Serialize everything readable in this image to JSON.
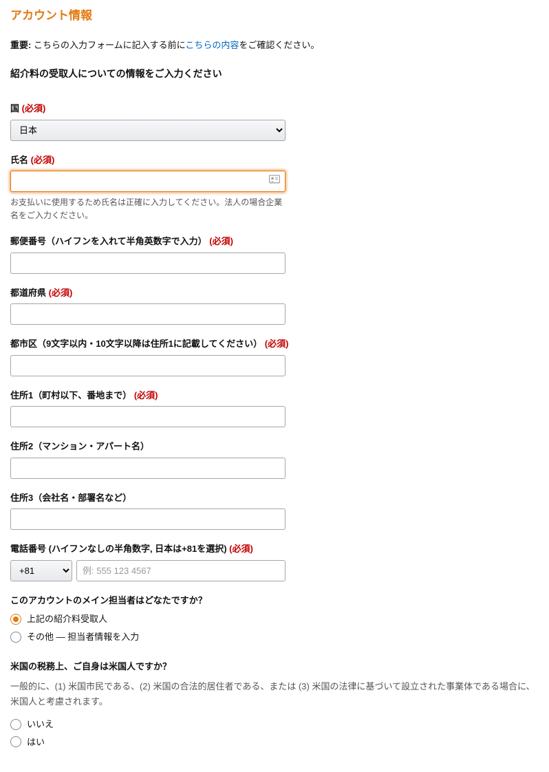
{
  "page_title": "アカウント情報",
  "notice": {
    "important_label": "重要:",
    "text_before": " こちらの入力フォームに記入する前に",
    "link_text": "こちらの内容",
    "text_after": "をご確認ください。"
  },
  "section_heading": "紹介料の受取人についての情報をご入力ください",
  "required_text": "(必須)",
  "country": {
    "label": "国 ",
    "value": "日本"
  },
  "name": {
    "label": "氏名 ",
    "help": "お支払いに使用するため氏名は正確に入力してください。法人の場合企業名をご入力ください。"
  },
  "postal": {
    "label": "郵便番号（ハイフンを入れて半角英数字で入力） "
  },
  "prefecture": {
    "label": "都道府県 "
  },
  "city": {
    "label": "都市区（9文字以内・10文字以降は住所1に記載してください） "
  },
  "address1": {
    "label": "住所1（町村以下、番地まで） "
  },
  "address2": {
    "label": "住所2（マンション・アパート名）"
  },
  "address3": {
    "label": "住所3（会社名・部署名など）"
  },
  "phone": {
    "label": "電話番号 (ハイフンなしの半角数字, 日本は+81を選択) ",
    "prefix": "+81",
    "placeholder": "例: 555 123 4567"
  },
  "main_contact": {
    "question": "このアカウントのメイン担当者はどなたですか？",
    "option1": "上記の紹介料受取人",
    "option2": "その他 — 担当者情報を入力"
  },
  "us_tax": {
    "question": "米国の税務上、ご自身は米国人ですか？",
    "description": "一般的に、(1) 米国市民である、(2) 米国の合法的居住者である、または (3) 米国の法律に基づいて設立された事業体である場合に、米国人と考慮されます。",
    "option_no": "いいえ",
    "option_yes": "はい"
  }
}
